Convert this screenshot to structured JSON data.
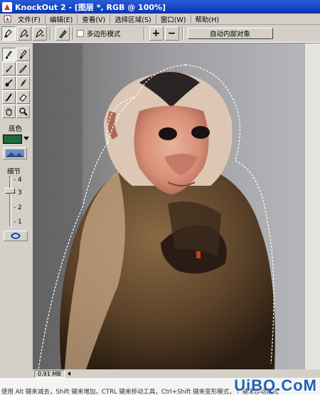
{
  "window": {
    "title": "KnockOut 2 - [图层 *, RGB @ 100%]"
  },
  "menu": [
    {
      "label": "文件(F)"
    },
    {
      "label": "编辑(E)"
    },
    {
      "label": "查看(V)"
    },
    {
      "label": "选择区域(S)"
    },
    {
      "label": "窗口(W)"
    },
    {
      "label": "帮助(H)"
    }
  ],
  "toolbar": {
    "polygon_mode_label": "多边形模式",
    "plus_label": "+",
    "minus_label": "−",
    "auto_inner_label": "自动内部对象"
  },
  "tools": {
    "color_label": "底色",
    "detail_label": "细节",
    "slider_ticks": [
      "4",
      "3",
      "2",
      "1"
    ],
    "slider_value": 3,
    "swatch_color": "#1e6b3a"
  },
  "status": {
    "file_size": "0.91 MB"
  },
  "hint": {
    "text": "使用 Alt 键来减去，Shift 键来增加，CTRL 键来移动工具，Ctrl+Shift 键来变形模式，↑ 键来移动模式"
  },
  "watermark": {
    "text": "UiBQ.CoM"
  }
}
